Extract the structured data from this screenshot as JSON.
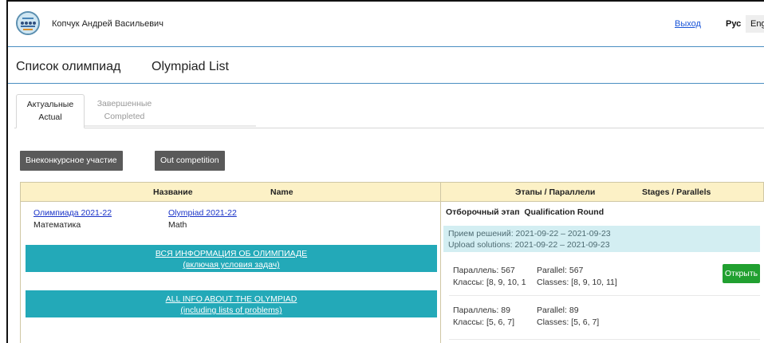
{
  "header": {
    "user_name": "Копчук Андрей Васильевич",
    "logout_label": "Выход",
    "lang_ru_label": "Рус",
    "lang_en_label": "Eng"
  },
  "page_title": {
    "ru": "Список олимпиад",
    "en": "Olympiad List"
  },
  "tabs": [
    {
      "ru": "Актуальные",
      "en": "Actual",
      "active": true
    },
    {
      "ru": "Завершенные",
      "en": "Completed",
      "active": false
    }
  ],
  "buttons": {
    "out_competition_ru": "Внеконкурсное участие",
    "out_competition_en": "Out competition"
  },
  "table": {
    "headers": {
      "name_ru": "Название",
      "name_en": "Name",
      "stages_ru": "Этапы / Параллели",
      "stages_en": "Stages / Parallels"
    },
    "olympiad": {
      "title_ru": "Олимпиада 2021-22",
      "title_en": "Olympiad 2021-22",
      "subject_ru": "Математика",
      "subject_en": "Math",
      "info_ru_line1": "ВСЯ ИНФОРМАЦИЯ ОБ ОЛИМПИАДЕ",
      "info_ru_line2": "(включая условия задач)",
      "info_en_line1": "ALL INFO ABOUT THE OLYMPIAD",
      "info_en_line2": "(including lists of problems)"
    },
    "stage": {
      "title_ru": "Отборочный этап",
      "title_en": "Qualification Round",
      "upload_ru": "Прием решений: 2021-09-22 – 2021-09-23",
      "upload_en": "Upload solutions: 2021-09-22 – 2021-09-23",
      "parallels": [
        {
          "par_ru": "Параллель: 567",
          "par_en": "Parallel: 567",
          "classes_ru": "Классы: [8, 9, 10, 1",
          "classes_en": "Classes: [8, 9, 10, 11]",
          "open_label": "Открыть"
        },
        {
          "par_ru": "Параллель: 89",
          "par_en": "Parallel: 89",
          "classes_ru": "Классы: [5, 6, 7]",
          "classes_en": "Classes: [5, 6, 7]"
        }
      ]
    }
  }
}
